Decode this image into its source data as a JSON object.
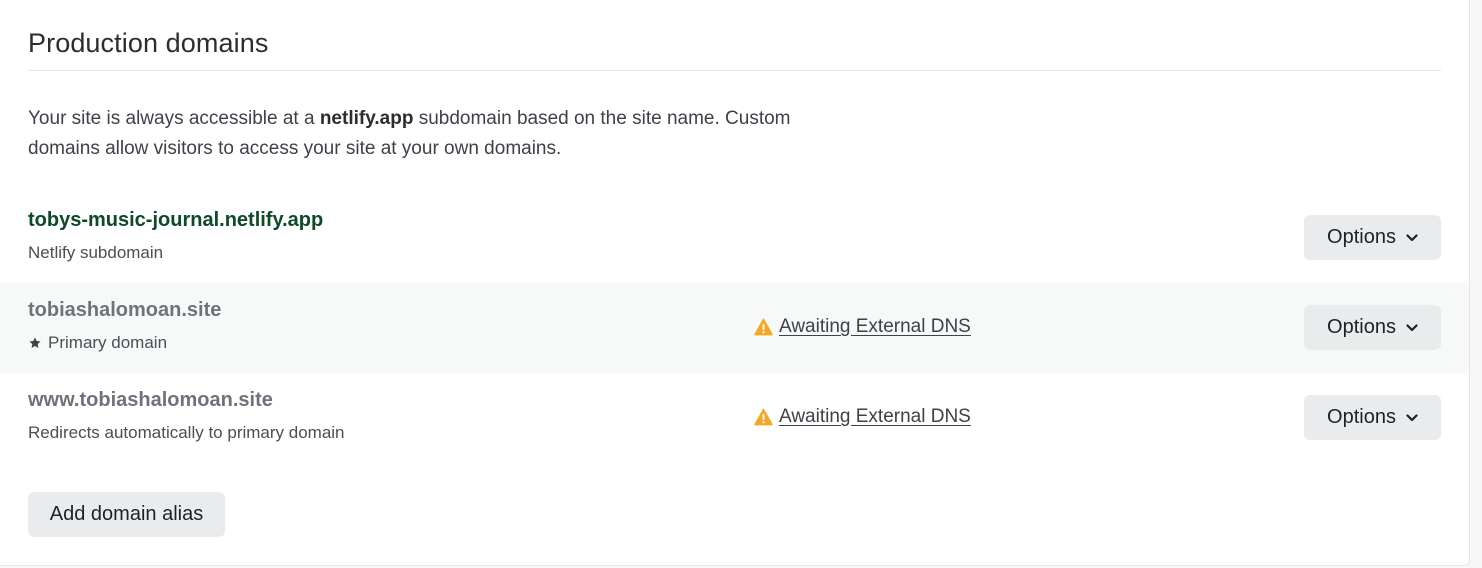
{
  "section": {
    "title": "Production domains",
    "intro_before": "Your site is always accessible at a ",
    "intro_bold": "netlify.app",
    "intro_after": " subdomain based on the site name. Custom domains allow visitors to access your site at your own domains."
  },
  "domains": [
    {
      "name": "tobys-music-journal.netlify.app",
      "subtitle": "Netlify subdomain",
      "status": "",
      "options_label": "Options"
    },
    {
      "name": "tobiashalomoan.site",
      "subtitle": "Primary domain",
      "status": "Awaiting External DNS",
      "options_label": "Options"
    },
    {
      "name": "www.tobiashalomoan.site",
      "subtitle": "Redirects automatically to primary domain",
      "status": "Awaiting External DNS",
      "options_label": "Options"
    }
  ],
  "actions": {
    "add_alias_label": "Add domain alias"
  },
  "icons": {
    "primary": "star-icon",
    "status": "warning-icon",
    "dropdown": "chevron-down-icon"
  },
  "colors": {
    "netlify_subdomain_text": "#0d4a27",
    "custom_domain_text": "#6e737b",
    "warning": "#f5a623",
    "button_bg": "#eaebed",
    "alt_row_bg": "#f7f9f8"
  }
}
